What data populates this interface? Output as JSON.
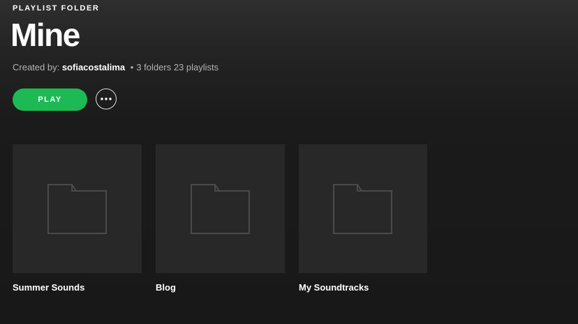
{
  "header": {
    "type_label": "PLAYLIST FOLDER",
    "title": "Mine",
    "created_by_prefix": "Created by:",
    "owner": "sofiacostalima",
    "separator": "•",
    "counts": "3 folders 23 playlists"
  },
  "actions": {
    "play_label": "PLAY",
    "more_icon": "more-horizontal-icon"
  },
  "colors": {
    "accent": "#1db954",
    "card_bg": "#282828",
    "folder_icon": "#4a4a4a"
  },
  "folders": [
    {
      "name": "Summer Sounds",
      "icon": "folder-icon"
    },
    {
      "name": "Blog",
      "icon": "folder-icon"
    },
    {
      "name": "My Soundtracks",
      "icon": "folder-icon"
    }
  ]
}
